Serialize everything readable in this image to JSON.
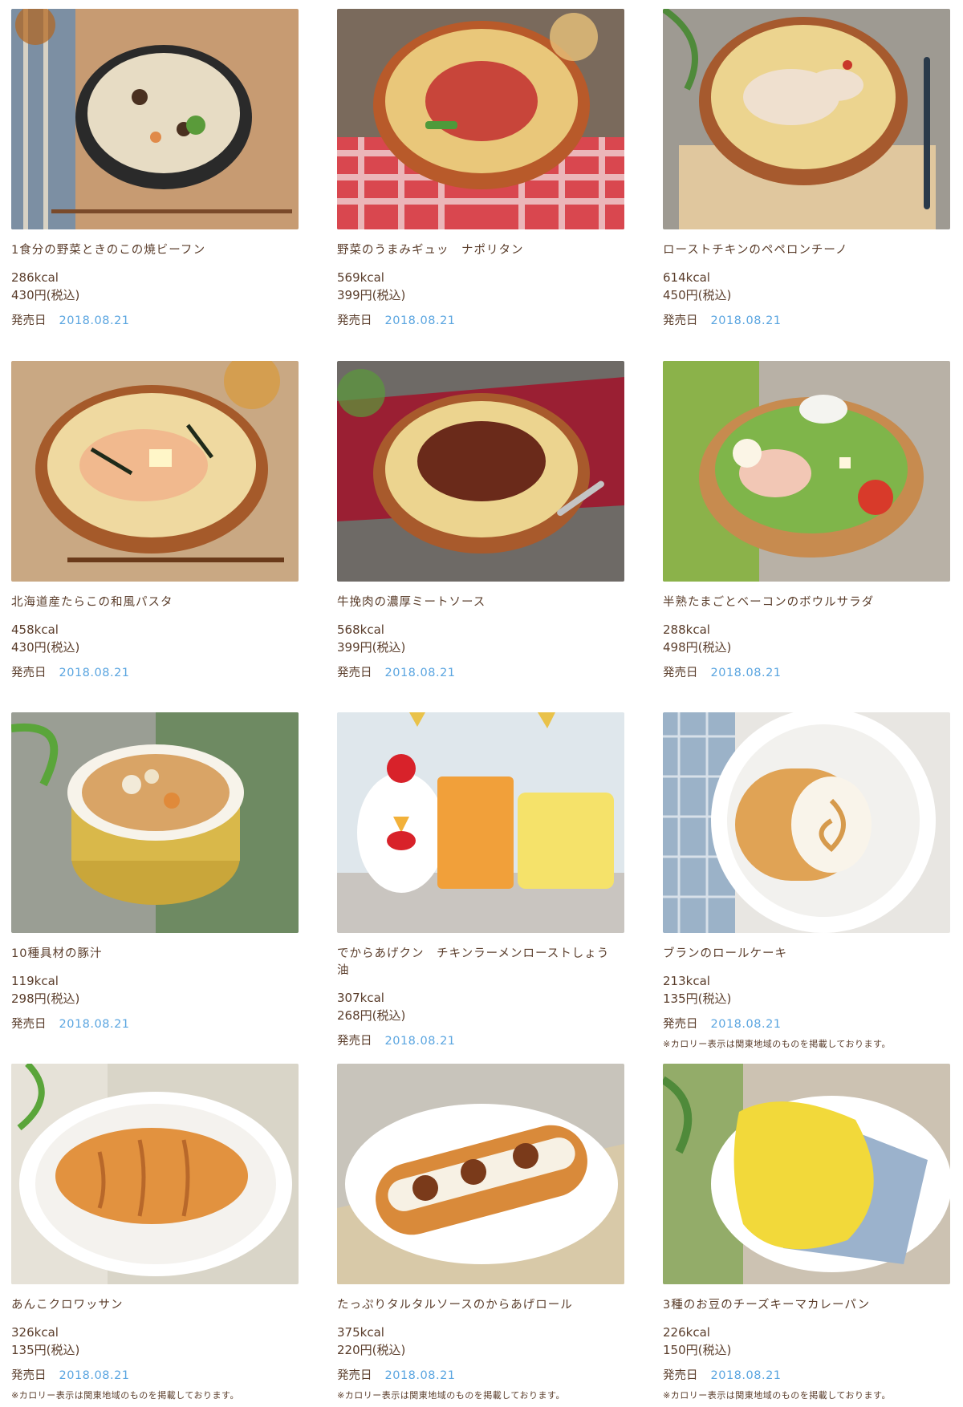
{
  "release_label": "発売日",
  "products": [
    {
      "name": "1食分の野菜ときのこの焼ビーフン",
      "kcal": "286kcal",
      "price": "430円(税込)",
      "date": "2018.08.21",
      "note": "",
      "image_icon": "yakibifun-bowl-photo"
    },
    {
      "name": "野菜のうまみギュッ　ナポリタン",
      "kcal": "569kcal",
      "price": "399円(税込)",
      "date": "2018.08.21",
      "note": "",
      "image_icon": "napolitan-pasta-photo"
    },
    {
      "name": "ローストチキンのペペロンチーノ",
      "kcal": "614kcal",
      "price": "450円(税込)",
      "date": "2018.08.21",
      "note": "",
      "image_icon": "peperoncino-pasta-photo"
    },
    {
      "name": "北海道産たらこの和風パスタ",
      "kcal": "458kcal",
      "price": "430円(税込)",
      "date": "2018.08.21",
      "note": "",
      "image_icon": "tarako-pasta-photo"
    },
    {
      "name": "牛挽肉の濃厚ミートソース",
      "kcal": "568kcal",
      "price": "399円(税込)",
      "date": "2018.08.21",
      "note": "",
      "image_icon": "meat-sauce-pasta-photo"
    },
    {
      "name": "半熟たまごとベーコンのボウルサラダ",
      "kcal": "288kcal",
      "price": "498円(税込)",
      "date": "2018.08.21",
      "note": "",
      "image_icon": "bowl-salad-photo"
    },
    {
      "name": "10種具材の豚汁",
      "kcal": "119kcal",
      "price": "298円(税込)",
      "date": "2018.08.21",
      "note": "",
      "image_icon": "tonjiru-soup-photo"
    },
    {
      "name": "でからあげクン　チキンラーメンローストしょう油",
      "kcal": "307kcal",
      "price": "268円(税込)",
      "date": "2018.08.21",
      "note": "",
      "image_icon": "karaage-kun-photo"
    },
    {
      "name": "ブランのロールケーキ",
      "kcal": "213kcal",
      "price": "135円(税込)",
      "date": "2018.08.21",
      "note": "※カロリー表示は関東地域のものを掲載しております。",
      "image_icon": "roll-cake-photo"
    },
    {
      "name": "あんこクロワッサン",
      "kcal": "326kcal",
      "price": "135円(税込)",
      "date": "2018.08.21",
      "note": "※カロリー表示は関東地域のものを掲載しております。",
      "image_icon": "croissant-photo"
    },
    {
      "name": "たっぷりタルタルソースのからあげロール",
      "kcal": "375kcal",
      "price": "220円(税込)",
      "date": "2018.08.21",
      "note": "※カロリー表示は関東地域のものを掲載しております。",
      "image_icon": "karaage-roll-photo"
    },
    {
      "name": "3種のお豆のチーズキーマカレーパン",
      "kcal": "226kcal",
      "price": "150円(税込)",
      "date": "2018.08.21",
      "note": "※カロリー表示は関東地域のものを掲載しております。",
      "image_icon": "curry-bread-photo"
    }
  ]
}
